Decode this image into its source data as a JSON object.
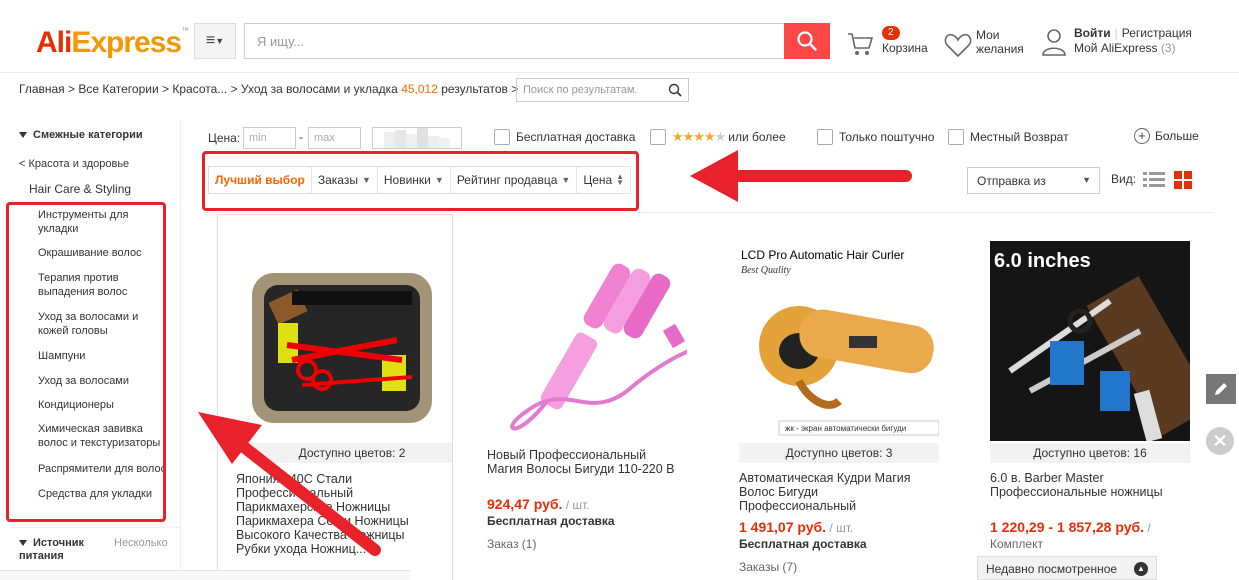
{
  "header": {
    "logo_ali": "Ali",
    "logo_express": "Express",
    "search_placeholder": "Я ищу...",
    "cart_count": "2",
    "cart_label": "Корзина",
    "wishlist_line1": "Мои",
    "wishlist_line2": "желания",
    "signin": "Войти",
    "register": "Регистрация",
    "my_account": "Мой AliExpress",
    "my_account_count": "(3)"
  },
  "breadcrumb": {
    "text_before": "Главная > Все Категории > Красота... > Уход за волосами и укладка ",
    "count": "45,012",
    "text_after": " результатов >",
    "refine_placeholder": "Поиск по результатам."
  },
  "sidebar": {
    "related_heading": "Смежные категории",
    "back_link": "< Красота и здоровье",
    "parent": "Hair Care & Styling",
    "items": [
      "Инструменты для укладки",
      "Окрашивание волос",
      "Терапия против выпадения волос",
      "Уход за волосами и кожей головы",
      "Шампуни",
      "Уход за волосами",
      "Кондиционеры",
      "Химическая завивка волос и текстуризаторы",
      "Распрямители для волос",
      "Средства для укладки"
    ],
    "source_heading": "Источник питания",
    "source_more": "Несколько"
  },
  "filters": {
    "price_label": "Цена:",
    "min_placeholder": "min",
    "max_placeholder": "max",
    "free_shipping": "Бесплатная доставка",
    "rating_suffix": "или более",
    "rating_value": 4,
    "single_piece": "Только поштучно",
    "local_return": "Местный Возврат",
    "more": "Больше"
  },
  "sort": {
    "best": "Лучший выбор",
    "orders": "Заказы",
    "newest": "Новинки",
    "seller_rating": "Рейтинг продавца",
    "price": "Цена",
    "ship_from": "Отправка из",
    "view_label": "Вид:"
  },
  "products": [
    {
      "colors": "Доступно цветов: 2",
      "title": "Япония 440C Стали Профессиональный Парикмахерские Ножницы Парикмахера Сетки Ножницы Высокого Качества Ножницы Рубки ухода Ножниц..."
    },
    {
      "title": "Новый Профессиональный Магия Волосы Бигуди 110-220 В",
      "price": "924,47 руб.",
      "unit": " / шт.",
      "shipping": "Бесплатная доставка",
      "orders": "Заказ (1)"
    },
    {
      "image_heading": "LCD Pro Automatic Hair Curler",
      "image_sub": "Best Quality",
      "image_caption": "жк - экран автоматически бигуди",
      "colors": "Доступно цветов: 3",
      "title": "Автоматическая Кудри Магия Волос Бигуди Профессиональный",
      "price": "1 491,07 руб.",
      "unit": " / шт.",
      "shipping": "Бесплатная доставка",
      "orders": "Заказы (7)"
    },
    {
      "image_heading": "6.0 inches",
      "colors": "Доступно цветов: 16",
      "title": "6.0 в. Barber Master Профессиональные ножницы",
      "price": "1 220,29 - 1 857,28 руб.",
      "unit": " /",
      "sub": "Комплект"
    }
  ],
  "recently_viewed": "Недавно посмотренное",
  "colors": {
    "accent": "#e62e04",
    "orange": "#f60",
    "annotation_red": "#e8212b"
  }
}
